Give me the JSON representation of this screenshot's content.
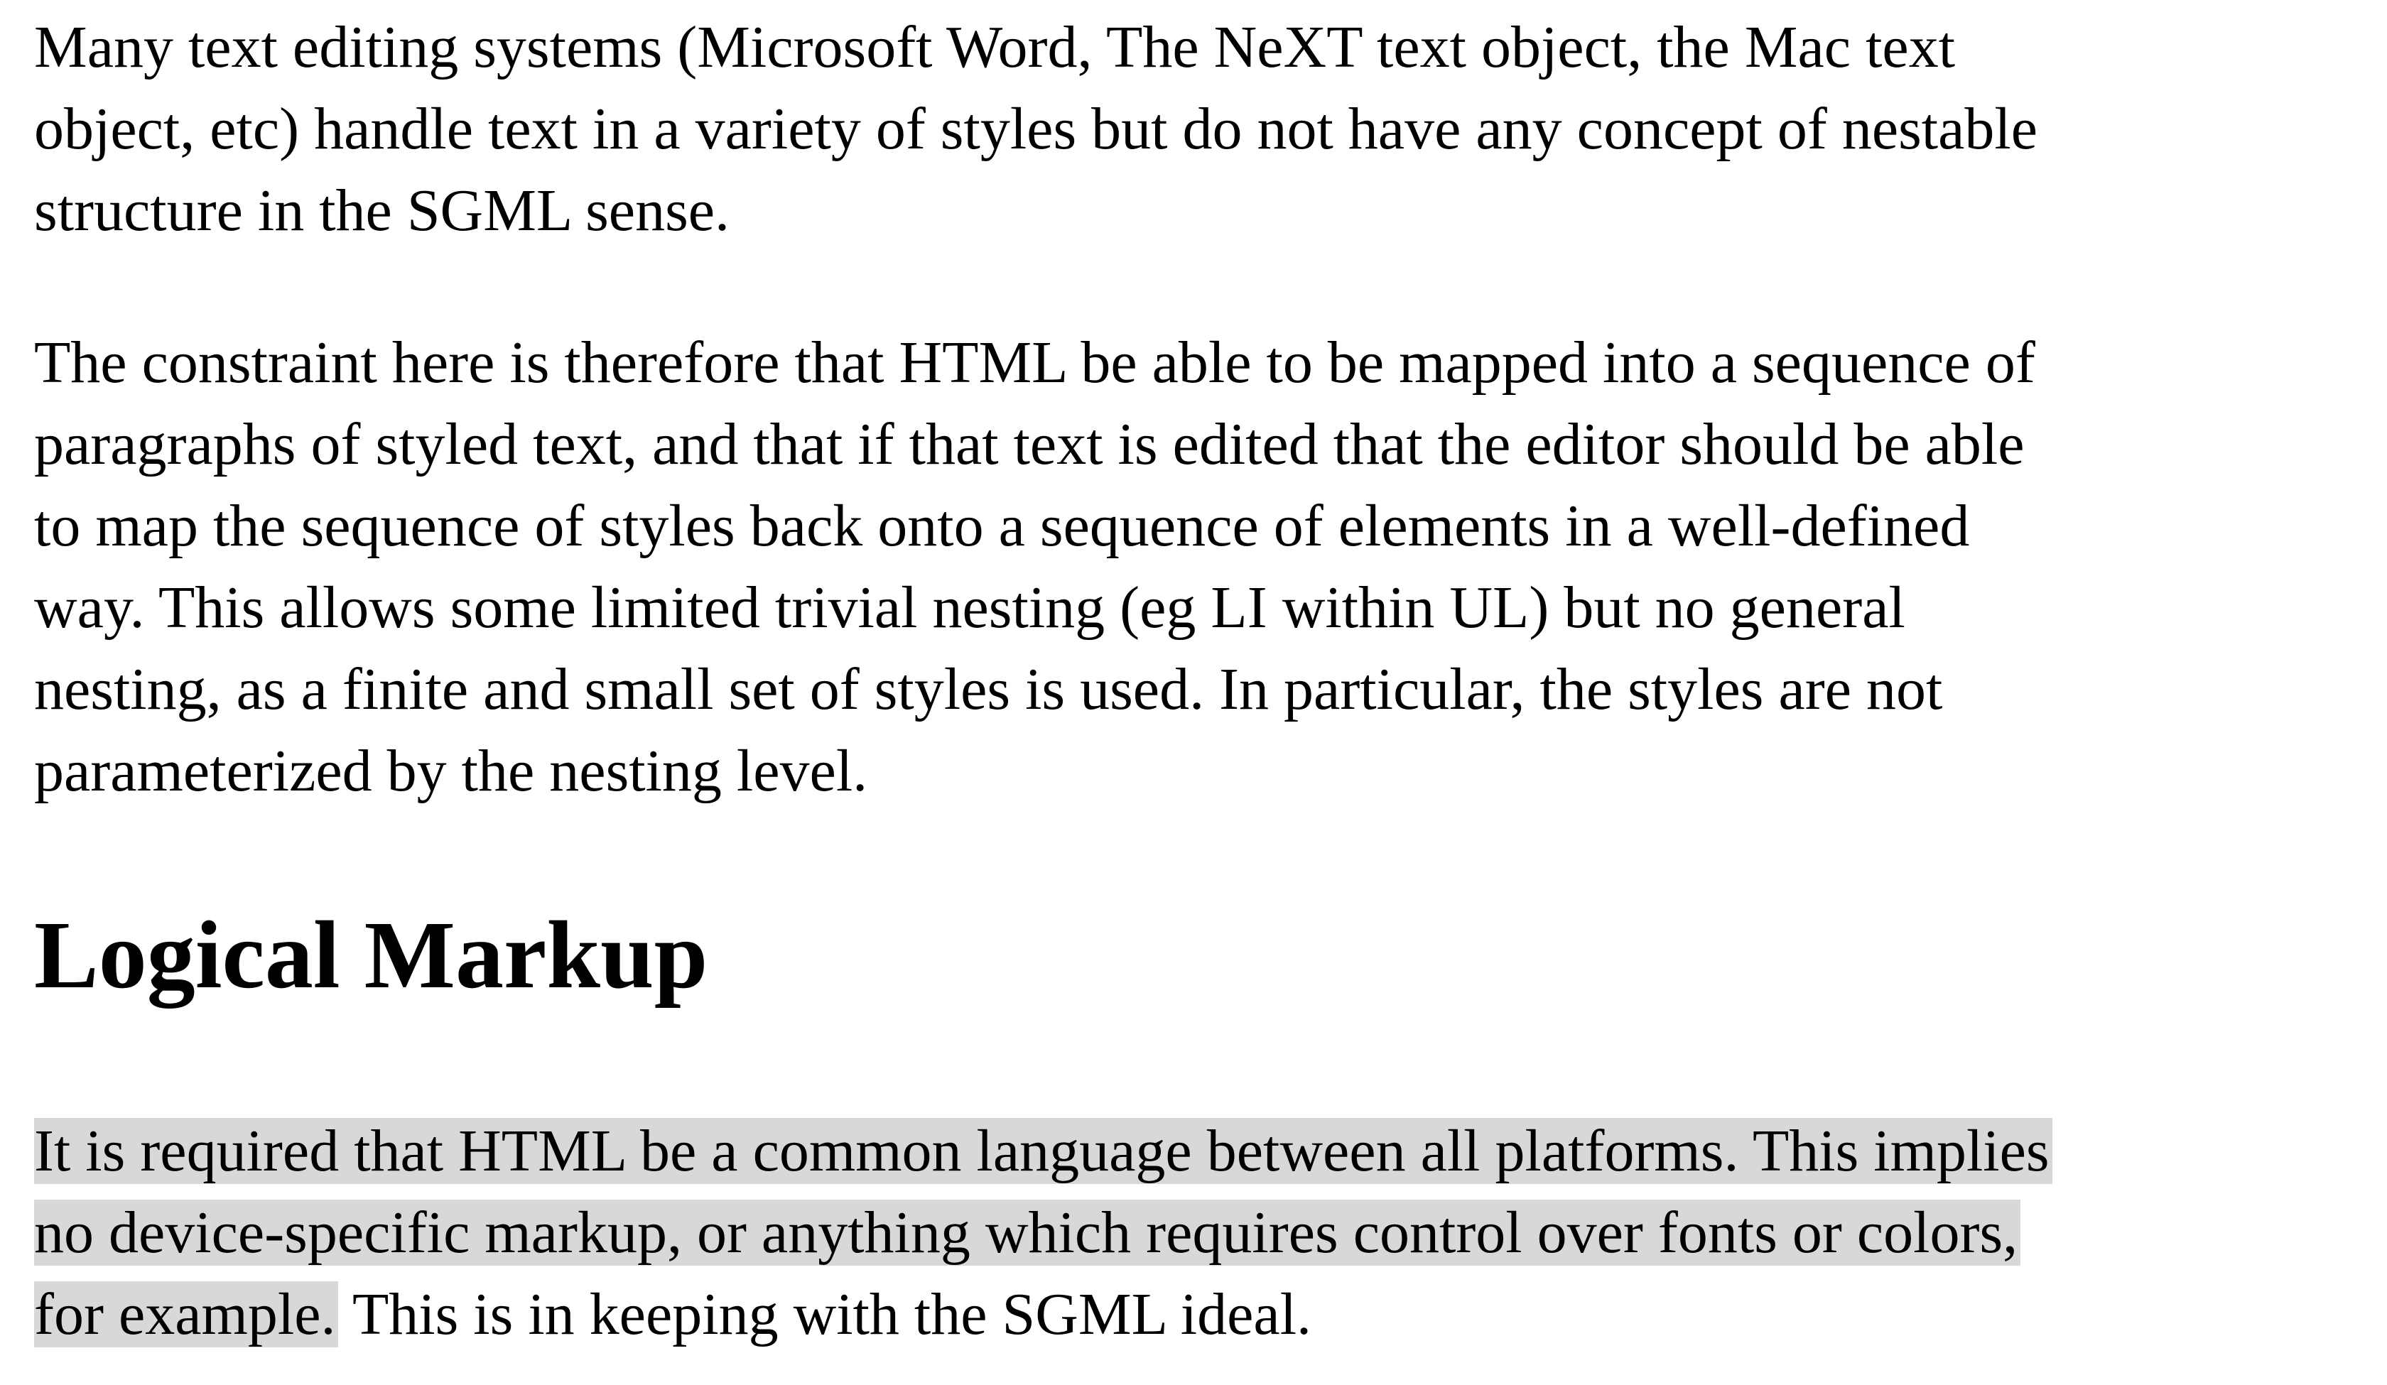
{
  "paragraphs": {
    "p1": [
      "Many text editing systems (Microsoft Word, The NeXT text object, the Mac text",
      "object, etc) handle text in a variety of styles but do not have any concept of nestable",
      "structure in the SGML sense."
    ],
    "p2": [
      "The constraint here is therefore that HTML be able to be mapped into a sequence of",
      "paragraphs of styled text, and that if that text is edited that the editor should be able",
      "to map the sequence of styles back onto a sequence of elements in a well-defined",
      "way. This allows some limited trivial nesting (eg LI within UL) but no general",
      "nesting, as a finite and small set of styles is used. In particular, the styles are not",
      "parameterized by the nesting level."
    ]
  },
  "heading": "Logical Markup",
  "p3": {
    "line1_selected": "It is required that HTML be a common language between all platforms. This implies",
    "line2_selected": "no device-specific markup, or anything which requires control over fonts or colors,",
    "line3_selected": "for example.",
    "line3_rest": " This is in keeping with the SGML ideal."
  },
  "selection_color": "#d8d8d8"
}
